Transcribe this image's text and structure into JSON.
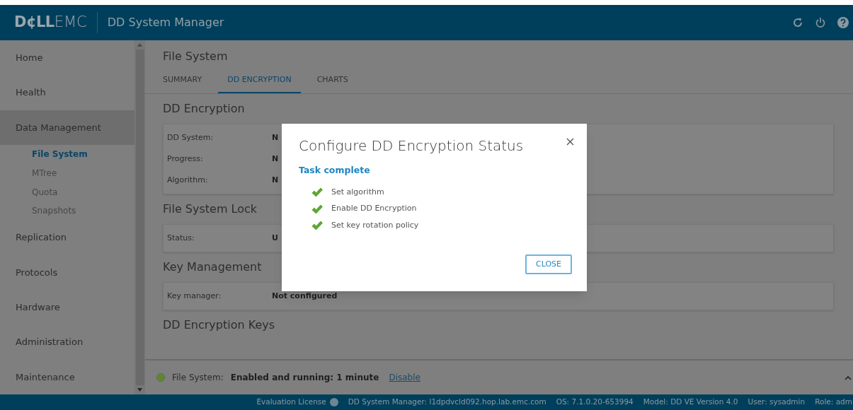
{
  "header": {
    "brand_bold": "D¢LL",
    "brand_light": "EMC",
    "title": "DD System Manager"
  },
  "sidebar": {
    "items": [
      {
        "label": "Home",
        "selected": false
      },
      {
        "label": "Health",
        "selected": false
      },
      {
        "label": "Data Management",
        "selected": true,
        "children": [
          {
            "label": "File System",
            "selected": true
          },
          {
            "label": "MTree",
            "selected": false
          },
          {
            "label": "Quota",
            "selected": false
          },
          {
            "label": "Snapshots",
            "selected": false
          }
        ]
      },
      {
        "label": "Replication",
        "selected": false
      },
      {
        "label": "Protocols",
        "selected": false
      },
      {
        "label": "Hardware",
        "selected": false
      },
      {
        "label": "Administration",
        "selected": false
      },
      {
        "label": "Maintenance",
        "selected": false
      }
    ]
  },
  "page": {
    "title": "File System",
    "tabs": [
      {
        "label": "SUMMARY",
        "selected": false
      },
      {
        "label": "DD ENCRYPTION",
        "selected": true
      },
      {
        "label": "CHARTS",
        "selected": false
      }
    ],
    "sections": [
      {
        "title": "DD Encryption",
        "rows": [
          {
            "label": "DD System:",
            "value": "N"
          },
          {
            "label": "Progress:",
            "value": "N"
          },
          {
            "label": "Algorithm:",
            "value": "N"
          }
        ]
      },
      {
        "title": "File System Lock",
        "rows": [
          {
            "label": "Status:",
            "value": "U"
          }
        ]
      },
      {
        "title": "Key Management",
        "rows": [
          {
            "label": "Key manager:",
            "value": "Not configured"
          }
        ]
      },
      {
        "title": "DD Encryption Keys"
      }
    ]
  },
  "footer": {
    "label": "File System:",
    "status": "Enabled and running: 1 minute",
    "link": "Disable",
    "on": true
  },
  "dialog": {
    "title": "Configure DD Encryption Status",
    "subtitle": "Task complete",
    "steps": [
      {
        "label": "Set algorithm",
        "done": true
      },
      {
        "label": "Enable DD Encryption",
        "done": true
      },
      {
        "label": "Set key rotation policy",
        "done": true
      }
    ],
    "button": "CLOSE"
  },
  "status_bar": {
    "license": "Evaluation License",
    "items": [
      "DD System Manager: l1dpdvcld092.hop.lab.emc.com",
      "OS: 7.1.0.20-653994",
      "Model: DD VE Version 4.0",
      "User: sysadmin",
      "Role: adm"
    ]
  }
}
